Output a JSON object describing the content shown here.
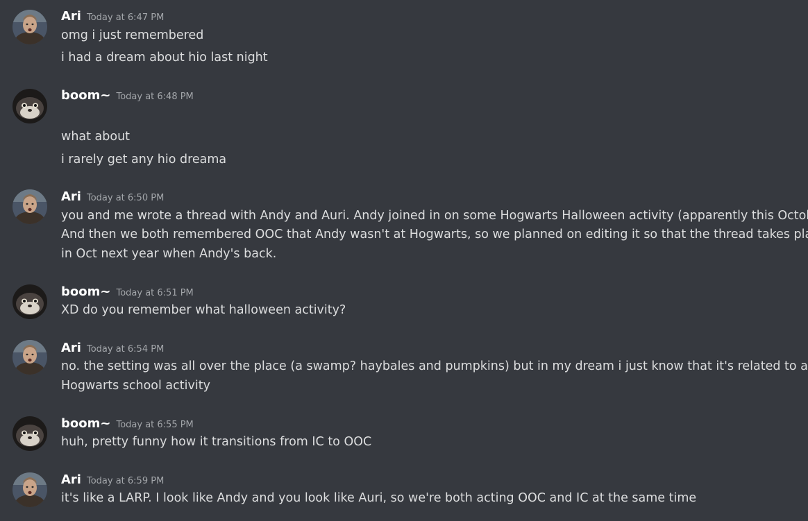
{
  "messages": [
    {
      "author": "Ari",
      "time": "Today at 6:47 PM",
      "lines": [
        "omg i just remembered",
        "i had a dream about hio last night"
      ]
    },
    {
      "author": "boom~",
      "time": "Today at 6:48 PM",
      "lines": [
        "what about",
        "i rarely get any hio dreama"
      ]
    },
    {
      "author": "Ari",
      "time": "Today at 6:50 PM",
      "lines": [
        "you and me wrote a thread with Andy and Auri. Andy joined in on some Hogwarts Halloween activity (apparently this October).",
        " And then we both remembered OOC that Andy wasn't at Hogwarts, so we planned on editing it so that the thread takes place",
        "in Oct next year when Andy's back."
      ]
    },
    {
      "author": "boom~",
      "time": "Today at 6:51 PM",
      "lines": [
        "XD do you remember what halloween activity?"
      ]
    },
    {
      "author": "Ari",
      "time": "Today at 6:54 PM",
      "lines": [
        "no.  the setting was all over the place (a swamp? haybales and pumpkins)  but in my dream i just know that it's related to a",
        "Hogwarts school activity"
      ]
    },
    {
      "author": "boom~",
      "time": "Today at 6:55 PM",
      "lines": [
        "huh, pretty funny how it transitions from IC to OOC"
      ]
    },
    {
      "author": "Ari",
      "time": "Today at 6:59 PM",
      "lines": [
        "it's like a LARP.  I look like Andy and you look like Auri, so we're both acting OOC and IC at the same time"
      ]
    }
  ]
}
